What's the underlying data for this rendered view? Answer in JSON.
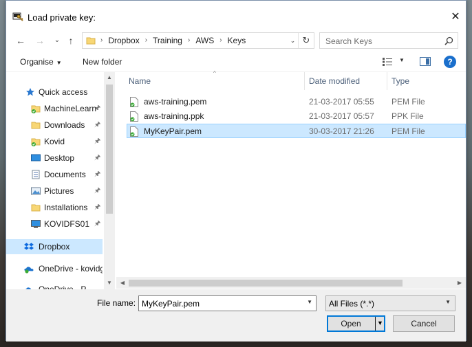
{
  "window": {
    "title": "Load private key:",
    "close_glyph": "✕"
  },
  "nav": {
    "back_glyph": "←",
    "forward_glyph": "→",
    "recent_glyph": "⌄",
    "up_glyph": "↑",
    "breadcrumbs": [
      "Dropbox",
      "Training",
      "AWS",
      "Keys"
    ],
    "separator": "›",
    "addr_dropdown_glyph": "⌄",
    "refresh_glyph": "↻"
  },
  "search": {
    "placeholder": "Search Keys"
  },
  "toolbar": {
    "organise_label": "Organise",
    "new_folder_label": "New folder",
    "caret": "▼",
    "help_glyph": "?"
  },
  "sidebar": {
    "items": [
      {
        "label": "Quick access",
        "icon": "star-icon"
      },
      {
        "label": "MachineLearn",
        "icon": "folder-synced-icon",
        "pinned": true
      },
      {
        "label": "Downloads",
        "icon": "folder-icon",
        "pinned": true
      },
      {
        "label": "Kovid",
        "icon": "folder-synced-icon",
        "pinned": true
      },
      {
        "label": "Desktop",
        "icon": "desktop-icon",
        "pinned": true
      },
      {
        "label": "Documents",
        "icon": "documents-icon",
        "pinned": true
      },
      {
        "label": "Pictures",
        "icon": "pictures-icon",
        "pinned": true
      },
      {
        "label": "Installations",
        "icon": "folder-icon",
        "pinned": true
      },
      {
        "label": "KOVIDFS01",
        "icon": "computer-icon",
        "pinned": true
      },
      {
        "label": "Dropbox",
        "icon": "dropbox-icon",
        "selected": true
      },
      {
        "label": "OneDrive - kovidg",
        "icon": "onedrive-icon"
      },
      {
        "label": "OneDrive - P",
        "icon": "onedrive-icon"
      }
    ],
    "pin_glyph": "📌"
  },
  "files": {
    "columns": {
      "name": "Name",
      "date": "Date modified",
      "type": "Type"
    },
    "rows": [
      {
        "name": "aws-training.pem",
        "date": "21-03-2017 05:55",
        "type": "PEM File"
      },
      {
        "name": "aws-training.ppk",
        "date": "21-03-2017 05:57",
        "type": "PPK File"
      },
      {
        "name": "MyKeyPair.pem",
        "date": "30-03-2017 21:26",
        "type": "PEM File",
        "selected": true
      }
    ]
  },
  "bottom": {
    "file_name_label": "File name:",
    "file_name_value": "MyKeyPair.pem",
    "filter_value": "All Files (*.*)",
    "open_label": "Open",
    "cancel_label": "Cancel"
  },
  "colors": {
    "accent": "#0078d7",
    "selection": "#cce8ff",
    "selection_border": "#99d1ff"
  }
}
